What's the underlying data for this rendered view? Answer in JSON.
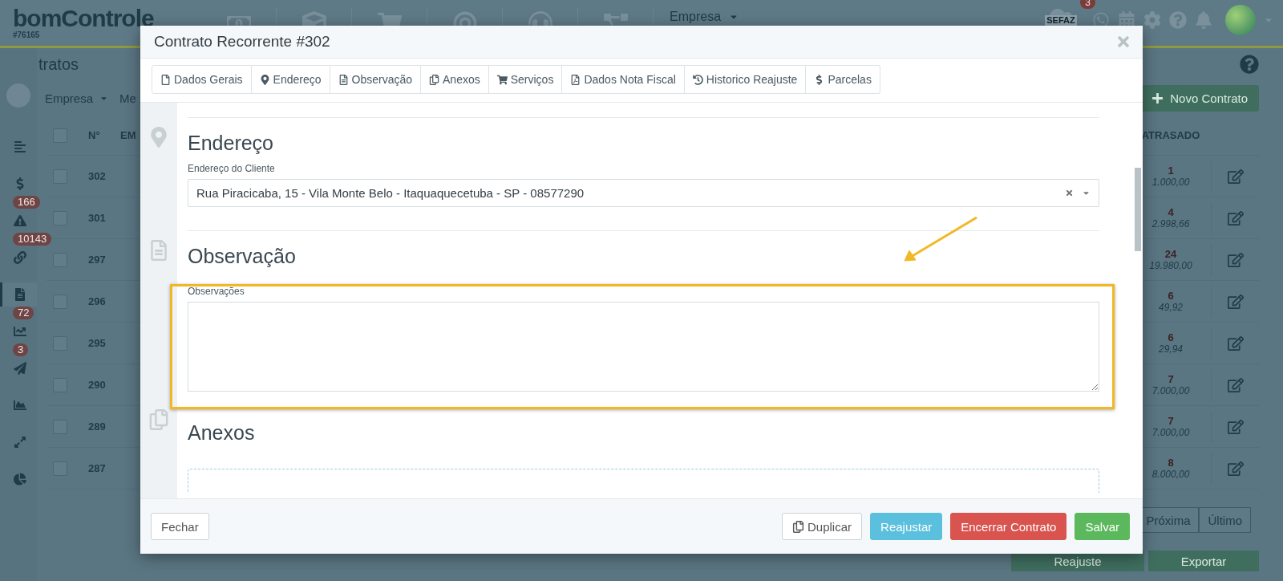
{
  "header": {
    "logo": "bomControle",
    "account": "#76165",
    "company": "Empresa",
    "sefaz": {
      "label": "SEFAZ",
      "count": "3"
    }
  },
  "sidebar": [
    {
      "selected": false
    },
    {
      "selected": false
    },
    {
      "selected": false,
      "badge": "166"
    },
    {
      "selected": false,
      "badge": "10143"
    },
    {
      "selected": true
    },
    {
      "selected": false,
      "badge": "72"
    },
    {
      "selected": false,
      "badge": "3"
    },
    {
      "selected": false
    },
    {
      "selected": false
    },
    {
      "selected": false
    }
  ],
  "page": {
    "title": "tratos",
    "filters": [
      "Empresa",
      "Me"
    ],
    "new_contract": "Novo Contrato",
    "columns": [
      "N°",
      "EM",
      "ATRASADO"
    ],
    "header_checked": false,
    "rows": [
      {
        "number": "302",
        "overdue_count": "1",
        "overdue_amount": "1.000,00",
        "checked": false
      },
      {
        "number": "301",
        "overdue_count": "4",
        "overdue_amount": "2.998,66",
        "checked": false
      },
      {
        "number": "297",
        "overdue_count": "24",
        "overdue_amount": "19.980,00",
        "checked": false
      },
      {
        "number": "296",
        "overdue_count": "6",
        "overdue_amount": "49,92",
        "checked": false
      },
      {
        "number": "295",
        "overdue_count": "6",
        "overdue_amount": "29,94",
        "checked": false
      },
      {
        "number": "290",
        "overdue_count": "7",
        "overdue_amount": "7.000,00",
        "checked": false
      },
      {
        "number": "289",
        "overdue_count": "7",
        "overdue_amount": "7.000,00",
        "checked": false
      },
      {
        "number": "287",
        "overdue_count": "8",
        "overdue_amount": "8.000,00",
        "checked": false
      }
    ],
    "pagination": [
      "Próxima",
      "Último"
    ],
    "actions": [
      "Reajuste",
      "Exportar"
    ]
  },
  "modal": {
    "title": "Contrato Recorrente #302",
    "tabs": [
      "Dados Gerais",
      "Endereço",
      "Observação",
      "Anexos",
      "Serviços",
      "Dados Nota Fiscal",
      "Historico Reajuste",
      "Parcelas"
    ],
    "address": {
      "heading": "Endereço",
      "label": "Endereço do Cliente",
      "value": "Rua Piracicaba, 15 - Vila Monte Belo - Itaquaquecetuba - SP - 08577290"
    },
    "observation": {
      "heading": "Observação",
      "label": "Observações"
    },
    "attachments": {
      "heading": "Anexos"
    },
    "footer": [
      {
        "label": "Fechar",
        "kind": "default"
      },
      {
        "label": "Duplicar",
        "kind": "copy"
      },
      {
        "label": "Reajustar",
        "kind": "info"
      },
      {
        "label": "Encerrar Contrato",
        "kind": "danger"
      },
      {
        "label": "Salvar",
        "kind": "success"
      }
    ]
  }
}
